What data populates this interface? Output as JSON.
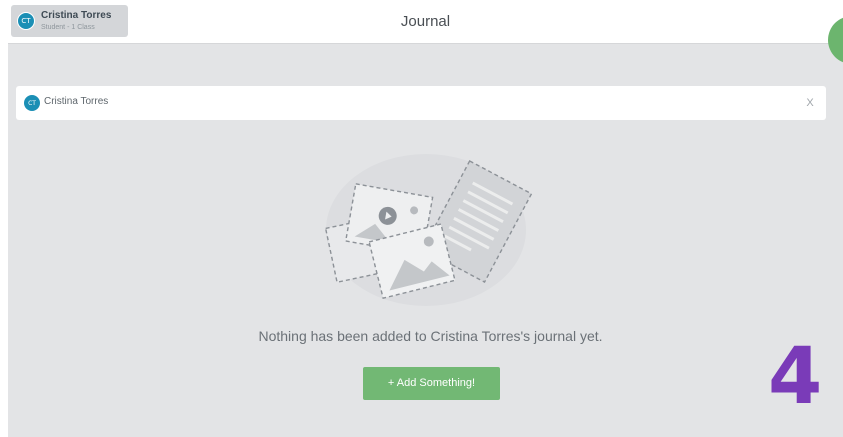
{
  "header": {
    "user": {
      "initials": "CT",
      "name": "Cristina Torres",
      "role": "Student - 1 Class"
    },
    "title": "Journal"
  },
  "filter": {
    "initials": "CT",
    "name": "Cristina Torres",
    "close_label": "X"
  },
  "empty_state": {
    "illustration_icon": "journal-empty-illustration",
    "message": "Nothing has been added to Cristina Torres's journal yet.",
    "add_button_label": "+ Add Something!"
  },
  "overlay_number": "4",
  "colors": {
    "accent_green": "#72b874",
    "avatar_blue": "#1b8fb5",
    "overlay_purple": "#7a3bb8"
  }
}
